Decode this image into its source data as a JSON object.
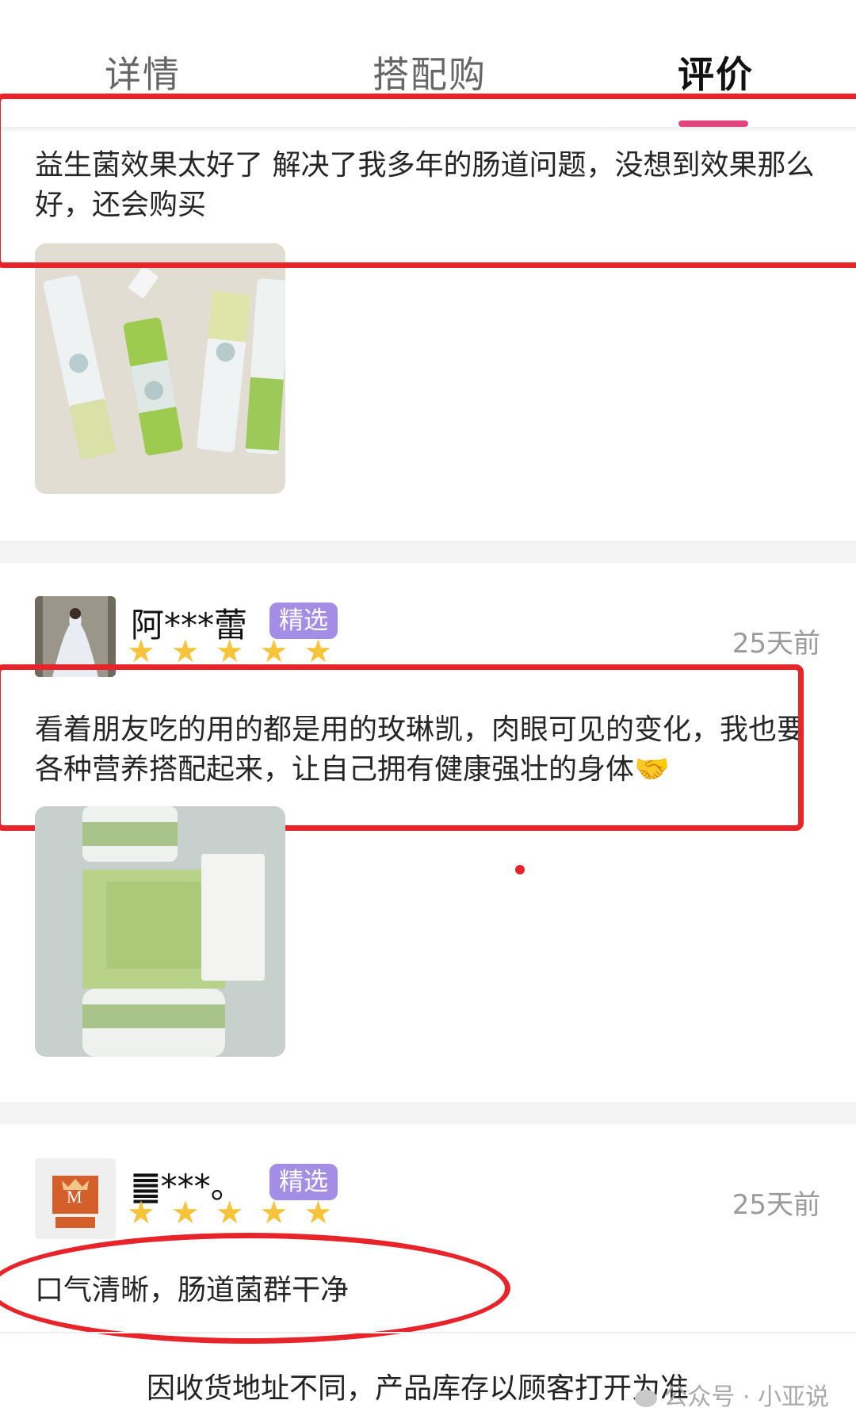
{
  "tabs": [
    {
      "label": "详情"
    },
    {
      "label": "搭配购"
    },
    {
      "label": "评价"
    }
  ],
  "active_tab": "评价",
  "reviews": [
    {
      "text": "益生菌效果太好了 解决了我多年的肠道问题，没想到效果那么好，还会购买"
    },
    {
      "username": "阿***蕾",
      "badge": "精选",
      "stars": "★★★★★",
      "rating": 5,
      "time": "25天前",
      "text": "看着朋友吃的用的都是用的玫琳凯，肉眼可见的变化，我也要各种营养搭配起来，让自己拥有健康强壮的身体🤝"
    },
    {
      "username": "䷀***。",
      "badge": "精选",
      "stars": "★★★★★",
      "rating": 5,
      "time": "25天前",
      "text": "口气清晰，肠道菌群干净"
    }
  ],
  "footer": {
    "notice": "因收货地址不同，产品库存以顾客打开为准",
    "watermark": "公众号 · 小亚说"
  },
  "colors": {
    "accent": "#e2457e",
    "badge": "#a48de4",
    "star": "#f6c33b",
    "annotation": "#e8242b"
  },
  "icons": {
    "avatar1_logo": "M"
  }
}
